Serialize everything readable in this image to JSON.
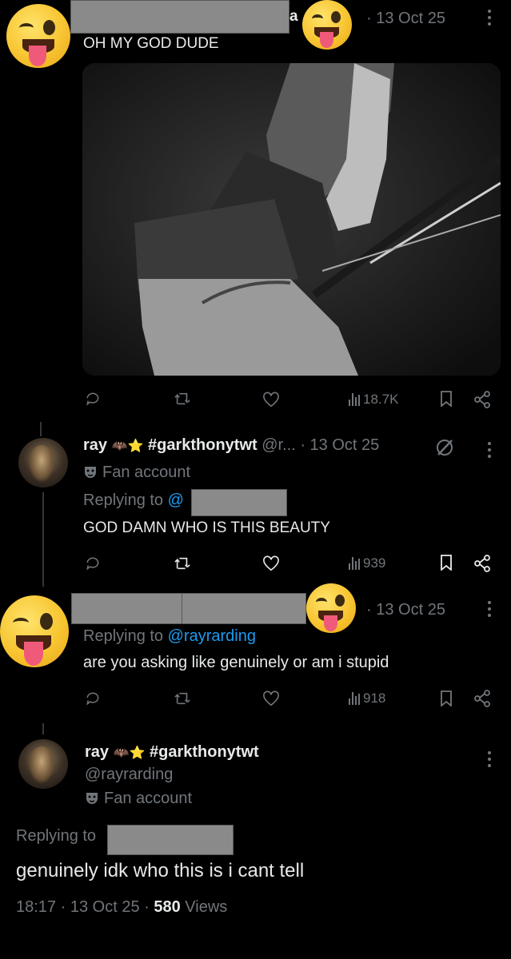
{
  "tweet1": {
    "handle_suffix": "a",
    "date": "· 13 Oct 25",
    "text": "OH MY GOD DUDE",
    "stats": {
      "views": "18.7K"
    }
  },
  "tweet2": {
    "name": "ray",
    "name_emoji": "🦇⭐",
    "hashtag": "#garkthonytwt",
    "handle": "@r...",
    "date": "· 13 Oct 25",
    "label": "Fan account",
    "replying_prefix": "Replying to",
    "replying_handle": "@",
    "text": "GOD DAMN WHO IS THIS BEAUTY",
    "stats": {
      "views": "939"
    }
  },
  "tweet3": {
    "date": "· 13 Oct 25",
    "replying_prefix": "Replying to",
    "replying_handle": "@rayrarding",
    "text": "are you asking like genuinely or am i stupid",
    "stats": {
      "views": "918"
    }
  },
  "tweet4": {
    "name": "ray",
    "name_emoji": "🦇⭐",
    "hashtag": "#garkthonytwt",
    "handle": "@rayrarding",
    "label": "Fan account",
    "replying_prefix": "Replying to",
    "text": "genuinely idk who this is i cant tell",
    "time": "18:17",
    "date": "· 13 Oct 25 ·",
    "views_count": "580",
    "views_label": "Views"
  },
  "colors": {
    "background": "#000000",
    "text": "#e7e9ea",
    "muted": "#71767b",
    "link": "#1d9bf0"
  },
  "icons": [
    "reply-icon",
    "retweet-icon",
    "like-icon",
    "views-icon",
    "bookmark-icon",
    "share-icon",
    "more-icon",
    "grok-icon",
    "fan-account-mask-icon"
  ]
}
